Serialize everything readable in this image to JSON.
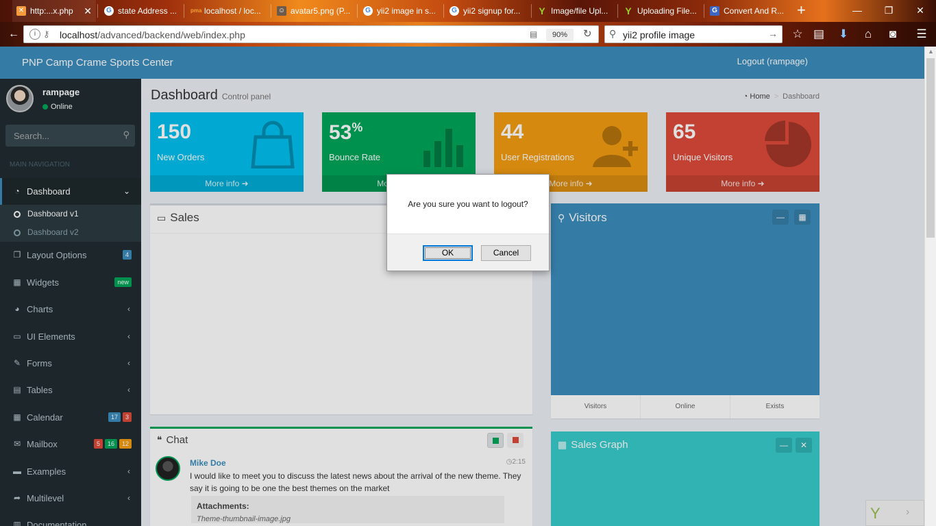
{
  "browser": {
    "tabs": [
      {
        "title": "http:...x.php",
        "icon": "xampp-icon",
        "active": true
      },
      {
        "title": "state Address ...",
        "icon": "google-icon"
      },
      {
        "title": "localhost / loc...",
        "icon": "phpmyadmin-icon"
      },
      {
        "title": "avatar5.png (P...",
        "icon": "image-icon"
      },
      {
        "title": "yii2 image in s...",
        "icon": "google-icon"
      },
      {
        "title": "yii2 signup for...",
        "icon": "google-icon"
      },
      {
        "title": "Image/file Upl...",
        "icon": "yii-icon"
      },
      {
        "title": "Uploading File...",
        "icon": "yii-icon"
      },
      {
        "title": "Convert And R...",
        "icon": "google-icon"
      }
    ],
    "url_host": "localhost",
    "url_path": "/advanced/backend/web/index.php",
    "zoom": "90%",
    "search_value": "yii2 profile image"
  },
  "app": {
    "brand": "PNP Camp Crame Sports Center",
    "logout_label": "Logout (rampage)"
  },
  "sidebar": {
    "user_name": "rampage",
    "status": "Online",
    "search_placeholder": "Search...",
    "header": "MAIN NAVIGATION",
    "items": [
      {
        "label": "Dashboard",
        "icon": "dashboard-icon",
        "chevron": "down",
        "active": true
      },
      {
        "label": "Layout Options",
        "icon": "files-icon",
        "badges": [
          {
            "text": "4",
            "color": "#3c8dbc"
          }
        ]
      },
      {
        "label": "Widgets",
        "icon": "th-icon",
        "badges": [
          {
            "text": "new",
            "color": "#00a65a"
          }
        ]
      },
      {
        "label": "Charts",
        "icon": "pie-chart-icon",
        "chevron": "left"
      },
      {
        "label": "UI Elements",
        "icon": "laptop-icon",
        "chevron": "left"
      },
      {
        "label": "Forms",
        "icon": "edit-icon",
        "chevron": "left"
      },
      {
        "label": "Tables",
        "icon": "table-icon",
        "chevron": "left"
      },
      {
        "label": "Calendar",
        "icon": "calendar-icon",
        "badges": [
          {
            "text": "17",
            "color": "#3c8dbc"
          },
          {
            "text": "3",
            "color": "#dd4b39"
          }
        ]
      },
      {
        "label": "Mailbox",
        "icon": "envelope-icon",
        "badges": [
          {
            "text": "5",
            "color": "#dd4b39"
          },
          {
            "text": "16",
            "color": "#00a65a"
          },
          {
            "text": "12",
            "color": "#f39c12"
          }
        ]
      },
      {
        "label": "Examples",
        "icon": "folder-icon",
        "chevron": "left"
      },
      {
        "label": "Multilevel",
        "icon": "share-icon",
        "chevron": "left"
      },
      {
        "label": "Documentation",
        "icon": "book-icon"
      }
    ],
    "sub_items": [
      {
        "label": "Dashboard v1",
        "active": true
      },
      {
        "label": "Dashboard v2",
        "active": false
      }
    ]
  },
  "page": {
    "title": "Dashboard",
    "subtitle": "Control panel",
    "breadcrumb": [
      "Home",
      "Dashboard"
    ]
  },
  "stats": [
    {
      "value": "150",
      "suffix": "",
      "label": "New Orders",
      "color": "#00c0ef",
      "icon": "shopping-bag-icon",
      "more": "More info"
    },
    {
      "value": "53",
      "suffix": "%",
      "label": "Bounce Rate",
      "color": "#00a65a",
      "icon": "bar-chart-icon",
      "more": "More info"
    },
    {
      "value": "44",
      "suffix": "",
      "label": "User Registrations",
      "color": "#f39c12",
      "icon": "user-plus-icon",
      "more": "More info"
    },
    {
      "value": "65",
      "suffix": "",
      "label": "Unique Visitors",
      "color": "#dd4b39",
      "icon": "pie-chart-icon",
      "more": "More info"
    }
  ],
  "sales": {
    "title": "Sales"
  },
  "visitors": {
    "title": "Visitors",
    "footer": [
      "Visitors",
      "Online",
      "Exists"
    ]
  },
  "chat": {
    "title": "Chat",
    "author": "Mike Doe",
    "time": "2:15",
    "message": "I would like to meet you to discuss the latest news about the arrival of the new theme. They say it is going to be one the best themes on the market",
    "attachments_label": "Attachments:",
    "attachment_file": "Theme-thumbnail-image.jpg"
  },
  "sales_graph": {
    "title": "Sales Graph"
  },
  "dialog": {
    "message": "Are you sure you want to logout?",
    "ok": "OK",
    "cancel": "Cancel"
  }
}
